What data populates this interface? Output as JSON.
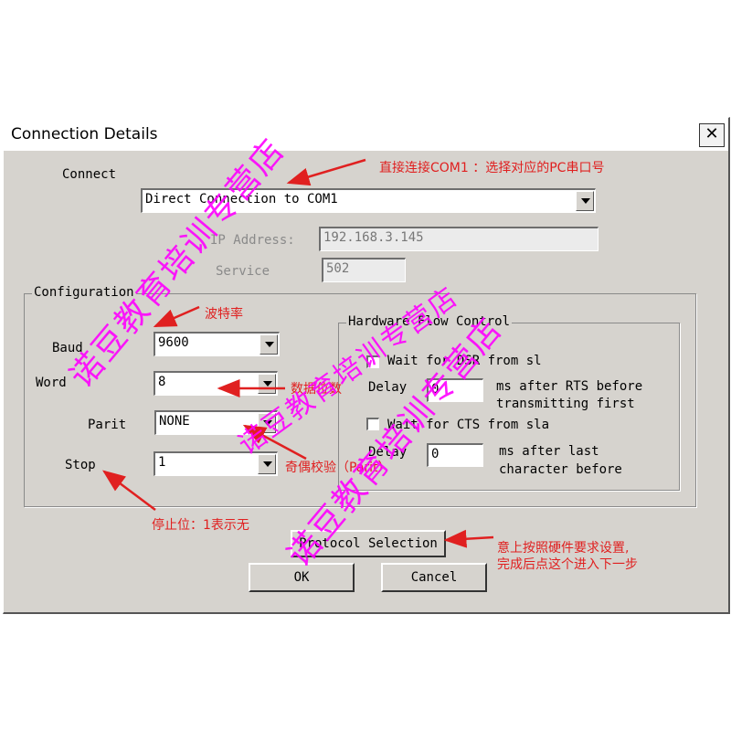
{
  "dialog": {
    "title": "Connection Details",
    "close_glyph": "✕"
  },
  "connect": {
    "label": "Connect",
    "value": "Direct Connection to COM1",
    "ip_label": "IP Address:",
    "ip_value": "192.168.3.145",
    "service_label": "Service",
    "service_value": "502"
  },
  "configuration": {
    "caption": "Configuration",
    "baud_label": "Baud",
    "baud_value": "9600",
    "word_label": "Word",
    "word_value": "8",
    "parity_label": "Parit",
    "parity_value": "NONE",
    "stop_label": "Stop",
    "stop_value": "1"
  },
  "hardware_flow": {
    "caption": "Hardware Flow Control",
    "dsr_label": "Wait for DSR from sl",
    "dsr_checked": false,
    "delay1_label": "Delay",
    "delay1_value": "0",
    "delay1_desc_1": "ms after RTS before",
    "delay1_desc_2": "transmitting first",
    "cts_label": "Wait for CTS from sla",
    "cts_checked": false,
    "delay2_label": "Delay",
    "delay2_value": "0",
    "delay2_desc_1": "ms after last",
    "delay2_desc_2": "character before"
  },
  "buttons": {
    "protocol": "Protocol Selection",
    "ok": "OK",
    "cancel": "Cancel"
  },
  "annotations": {
    "connect": "直接连接COM1 ：选择对应的PC串口号",
    "baud": "波特率",
    "word": "数据位数",
    "parity": "奇偶校验（Parit）",
    "stop": "停止位：1表示无",
    "protocol_1": "意上按照硬件要求设置,",
    "protocol_2": "完成后点这个进入下一步"
  },
  "watermarks": {
    "text_1": "诺豆教育培训专营店",
    "text_2": "诺豆教育培训专营店",
    "text_3": "诺豆教育培训专营店"
  },
  "colors": {
    "dialog_bg": "#d6d3ce",
    "annotation": "#e02020",
    "watermark": "#ff00ff"
  },
  "icons": {
    "close": "close-icon",
    "dropdown": "chevron-down-icon",
    "checkbox": "checkbox-icon",
    "arrow": "annotation-arrow-icon"
  }
}
